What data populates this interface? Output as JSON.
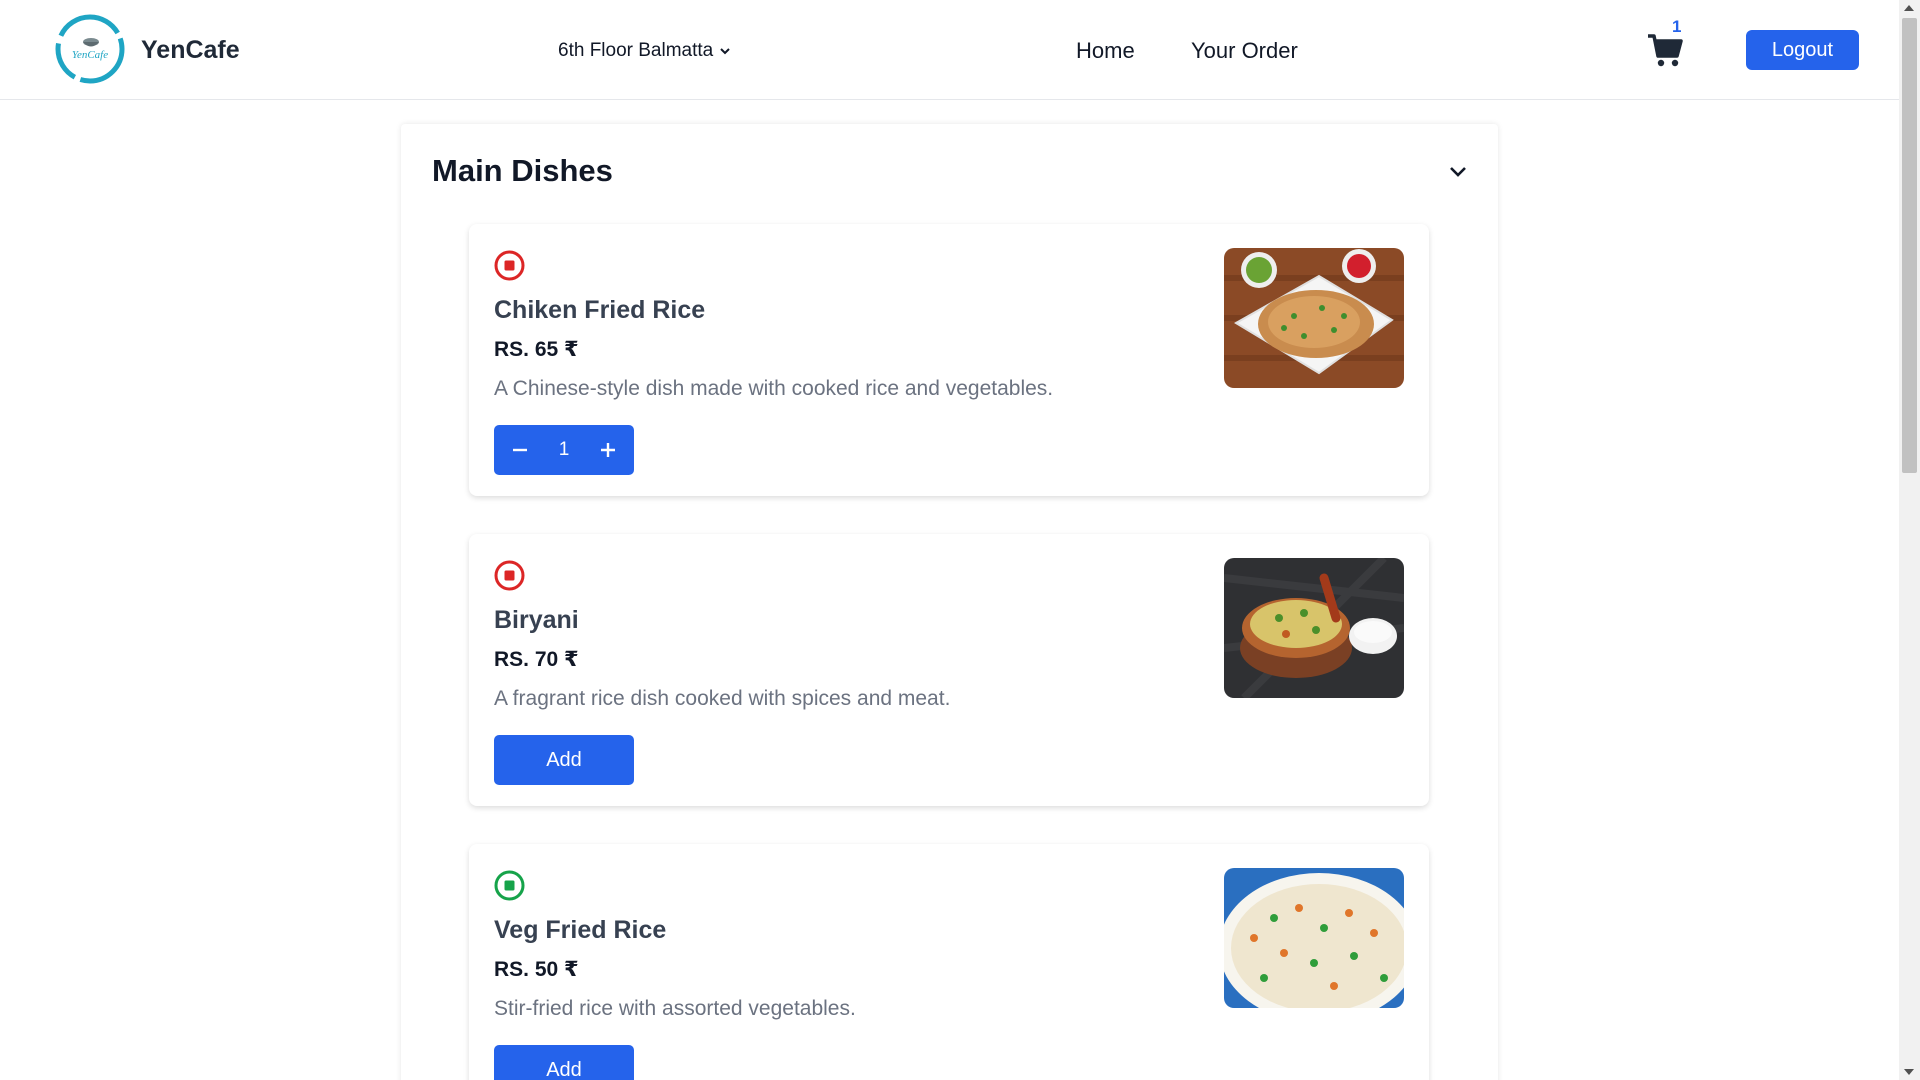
{
  "header": {
    "brand": "YenCafe",
    "logo_text": "YenCafe",
    "location": "6th Floor Balmatta",
    "nav": {
      "home": "Home",
      "your_order": "Your Order"
    },
    "cart_count": "1",
    "logout_label": "Logout"
  },
  "colors": {
    "accent": "#2563eb",
    "nonveg": "#dc2626",
    "veg": "#16a34a"
  },
  "section": {
    "title": "Main Dishes"
  },
  "dishes": [
    {
      "name": "Chiken Fried Rice",
      "price": "RS. 65 ₹",
      "description": "A Chinese-style dish made with cooked rice and vegetables.",
      "type": "non-veg",
      "quantity": "1"
    },
    {
      "name": "Biryani",
      "price": "RS. 70 ₹",
      "description": "A fragrant rice dish cooked with spices and meat.",
      "type": "non-veg",
      "button_label": "Add"
    },
    {
      "name": "Veg Fried Rice",
      "price": "RS. 50 ₹",
      "description": "Stir-fried rice with assorted vegetables.",
      "type": "veg",
      "button_label": "Add"
    }
  ]
}
